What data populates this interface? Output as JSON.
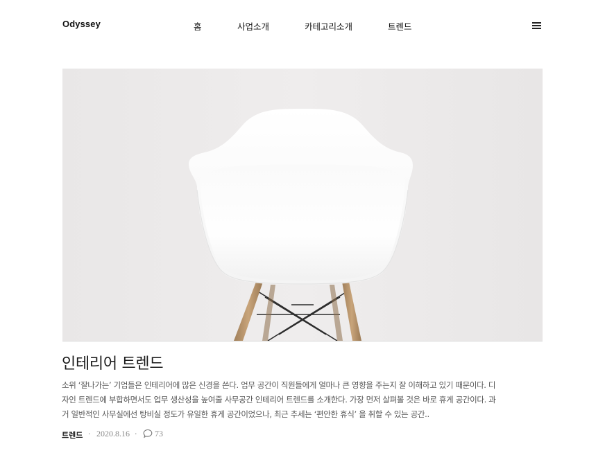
{
  "header": {
    "logo": "Odyssey",
    "nav": [
      "홈",
      "사업소개",
      "카테고리소개",
      "트렌드"
    ],
    "menu_icon": "hamburger-menu-icon"
  },
  "post": {
    "image_subject": "white molded plastic armchair with wooden legs",
    "title": "인테리어 트렌드",
    "excerpt_lines": [
      "소위 ‘잘나가는’ 기업들은 인테리어에 많은 신경을 쓴다. 업무 공간이 직원들에게 얼마나 큰 영향을 주는지 잘 이해하고 있기 때문이다. 디",
      "자인 트렌드에 부합하면서도 업무 생산성을 높여줄 사무공간 인테리어 트렌드를 소개한다. 가장 먼저 살펴볼 것은 바로 휴게 공간이다. 과",
      "거 일반적인 사무실에선 탕비실 정도가 유일한 휴게 공간이었으나, 최근 추세는 ‘편안한 휴식’ 을 취할 수 있는 공간.."
    ],
    "category": "트렌드",
    "separator": "·",
    "date": "2020.8.16",
    "comment_icon": "speech-bubble-icon",
    "comment_count": "73"
  },
  "colors": {
    "background": "#ffffff",
    "hero_background": "#eceaea",
    "text_primary": "#1a1a1a",
    "text_secondary": "#555555",
    "meta_text": "#888888"
  }
}
